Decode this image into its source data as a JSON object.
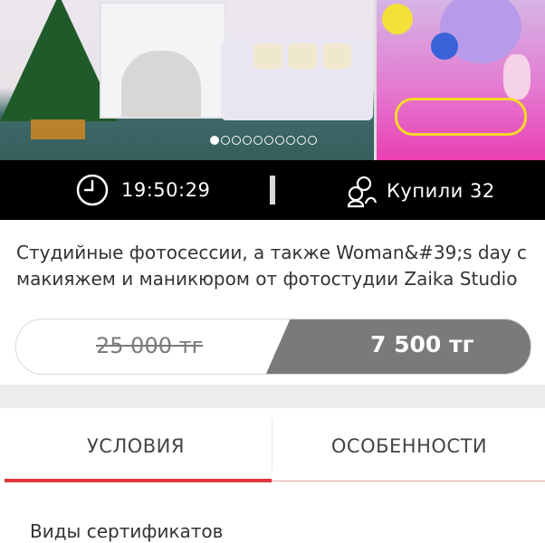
{
  "gallery": {
    "slide_count": 10,
    "active_slide": 1
  },
  "infobar": {
    "timer": "19:50:29",
    "bought": "Купили 32"
  },
  "offer": {
    "title": "Студийные фотосессии, а также Woman&#39;s day с макияжем и маникюром от фотостудии Zaika Studio",
    "old_price": "25 000 тг",
    "new_price": "7 500 тг"
  },
  "tabs": [
    {
      "label": "УСЛОВИЯ"
    },
    {
      "label": "ОСОБЕННОСТИ"
    }
  ],
  "details": {
    "section_heading": "Виды сертификатов"
  },
  "colors": {
    "accent": "#e0383e",
    "infobar_bg": "#000000",
    "price_bg": "#7a7a7a"
  }
}
